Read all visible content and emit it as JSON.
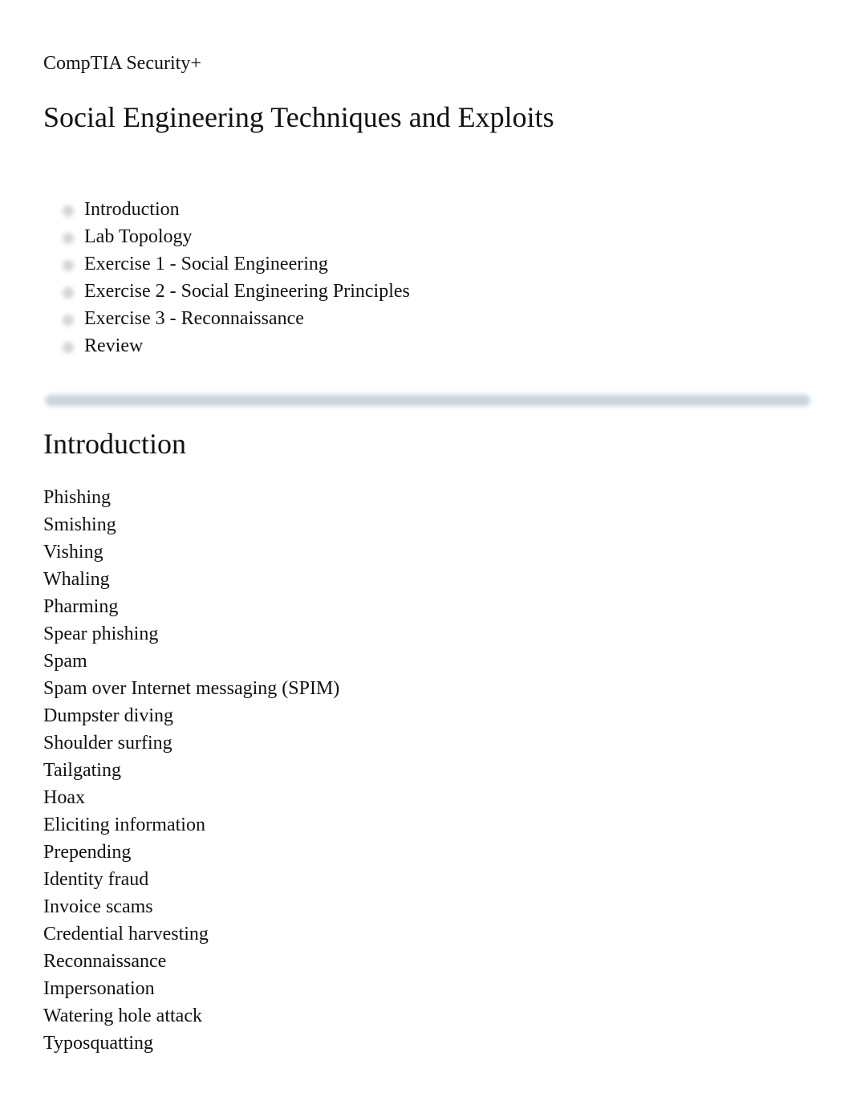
{
  "header": {
    "course": "CompTIA Security+",
    "title": "Social Engineering Techniques and Exploits"
  },
  "toc": {
    "items": [
      {
        "label": "Introduction",
        "icon": "bullet-icon"
      },
      {
        "label": "Lab Topology",
        "icon": "bullet-icon"
      },
      {
        "label": "Exercise 1 - Social Engineering",
        "icon": "bullet-icon"
      },
      {
        "label": "Exercise 2 - Social Engineering Principles",
        "icon": "bullet-icon"
      },
      {
        "label": "Exercise 3 - Reconnaissance",
        "icon": "bullet-icon"
      },
      {
        "label": "Review",
        "icon": "bullet-icon"
      }
    ]
  },
  "divider_color": "#c9d4dc",
  "introduction": {
    "heading": "Introduction",
    "topics": [
      "Phishing",
      "Smishing",
      "Vishing",
      "Whaling",
      "Pharming",
      "Spear phishing",
      "Spam",
      "Spam over Internet messaging (SPIM)",
      "Dumpster diving",
      "Shoulder surfing",
      "Tailgating",
      "Hoax",
      "Eliciting information",
      "Prepending",
      "Identity fraud",
      "Invoice scams",
      "Credential harvesting",
      "Reconnaissance",
      "Impersonation",
      "Watering hole attack",
      "Typosquatting"
    ]
  }
}
